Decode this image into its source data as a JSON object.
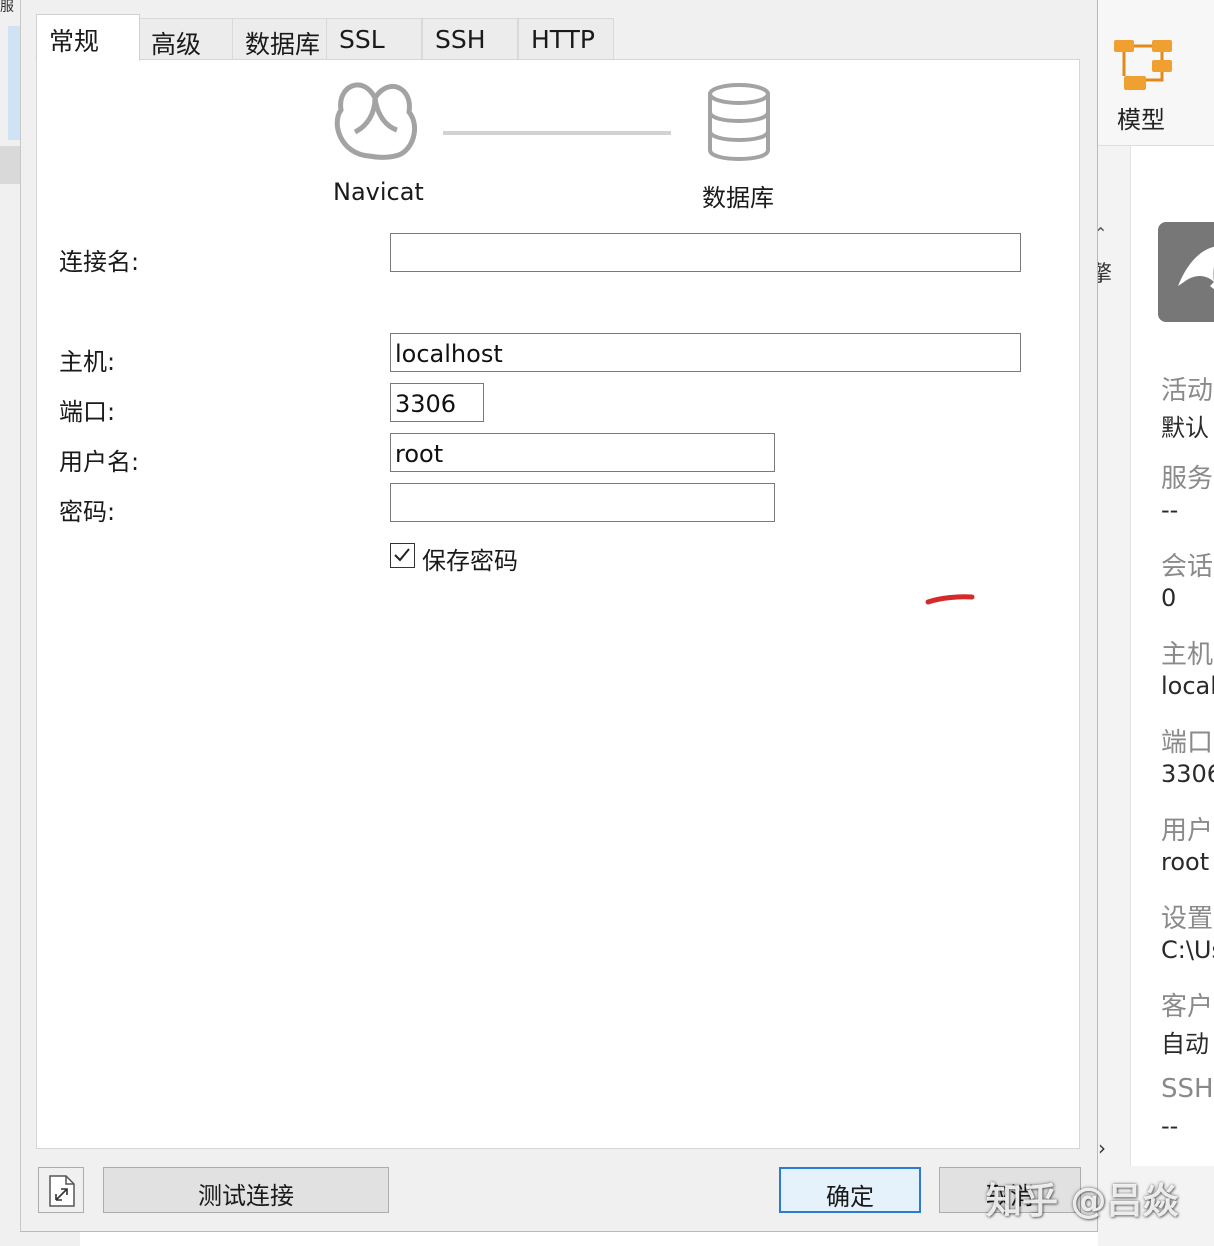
{
  "background": {
    "corner_text": "服",
    "toolbar": {
      "model_label": "模型"
    },
    "mid_text": "擎",
    "info": [
      {
        "label": "活动",
        "value": "默认"
      },
      {
        "label": "服务",
        "value": "--"
      },
      {
        "label": "会话",
        "value": "0"
      },
      {
        "label": "主机",
        "value": "local"
      },
      {
        "label": "端口",
        "value": "3306"
      },
      {
        "label": "用户",
        "value": "root"
      },
      {
        "label": "设置",
        "value": "C:\\Us"
      },
      {
        "label": "客户",
        "value": "自动"
      },
      {
        "label": "SSH",
        "value": "--"
      }
    ]
  },
  "dialog": {
    "tabs": [
      "常规",
      "高级",
      "数据库",
      "SSL",
      "SSH",
      "HTTP"
    ],
    "diagram": {
      "left_label": "Navicat",
      "right_label": "数据库"
    },
    "form": {
      "connection_name": {
        "label": "连接名:",
        "value": ""
      },
      "host": {
        "label": "主机:",
        "value": "localhost"
      },
      "port": {
        "label": "端口:",
        "value": "3306"
      },
      "username": {
        "label": "用户名:",
        "value": "root"
      },
      "password": {
        "label": "密码:",
        "value": ""
      },
      "save_password": {
        "label": "保存密码",
        "checked": true
      }
    },
    "footer": {
      "test_button": "测试连接",
      "ok_button": "确定",
      "cancel_button": "取消"
    }
  },
  "watermark": "知乎 @吕焱",
  "colors": {
    "accent": "#2d7ad4",
    "mark": "#d42a2a",
    "model_icon": "#f0a030"
  }
}
